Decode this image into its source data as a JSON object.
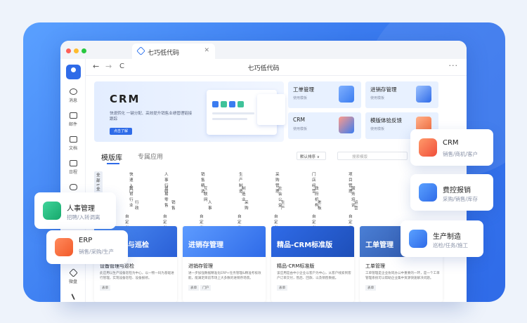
{
  "browser": {
    "tab_title": "七巧低代码",
    "address_title": "七巧低代码",
    "back": "←",
    "forward": "→",
    "reload": "C",
    "more": "···",
    "tab_close": "✕"
  },
  "sidebar": {
    "items": [
      {
        "label": "消息"
      },
      {
        "label": "邮件"
      },
      {
        "label": "文档"
      },
      {
        "label": "日程"
      },
      {
        "label": "会议"
      },
      {
        "label": "微盘"
      },
      {
        "label": "应用"
      }
    ]
  },
  "hero": {
    "title": "CRM",
    "desc": "快速转化 一键分配、高效提升销售业绩管理链接跟踪",
    "button": "点击了解"
  },
  "cards": [
    {
      "name": "工单管理",
      "sub": "使用模板"
    },
    {
      "name": "进销存管理",
      "sub": "使用模板"
    },
    {
      "name": "CRM",
      "sub": "使用模板"
    },
    {
      "name": "模版体验反馈",
      "sub": "使用模板"
    }
  ],
  "tabs": {
    "active": "模版库",
    "inactive": "专属应用"
  },
  "sort_label": "默认排序 ∨",
  "search_placeholder": "搜索模版",
  "filters": {
    "row1": [
      "全部场景",
      "快速入门",
      "人事行政",
      "销售精选",
      "生产制造",
      "采购管理",
      "门店经营",
      "项目管理"
    ],
    "row2": [
      "全部行业",
      "教育行业",
      "贸易零售",
      "互联网",
      "制造业",
      "社会公益",
      "政府机构",
      "服务培训"
    ],
    "row3": [
      "行政",
      "销售",
      "人事",
      "采购",
      "生产",
      "老板",
      "运营"
    ],
    "row4": [
      "自定义标签",
      "自定义标签",
      "自定义标签",
      "自定义标签",
      "自定义标签",
      "自定义标签",
      "自定义标签"
    ]
  },
  "templates": [
    {
      "img_title": "设备管理与巡检",
      "name": "设备管理与巡检",
      "desc": "此应用以生产设备巡检为中心，以一物一码为基础进行管理，实现设备巡检、设备报修。",
      "tags": [
        "表单"
      ]
    },
    {
      "img_title": "进销存管理",
      "name": "进销存管理",
      "desc": "进一步加强数据精准化ERP+任务管理&精准考核效能，能满足目前市场上大多数的进销存场景。",
      "tags": [
        "表单",
        "门户"
      ]
    },
    {
      "img_title": "精品-CRM标准版",
      "name": "精品-CRM标准版",
      "desc": "该应用是由中小企业以客户为中心，从客户线索到客户订单交付，售后、回款、以及销售数据。",
      "tags": [
        "表单"
      ]
    },
    {
      "img_title": "工单管理",
      "name": "工单管理",
      "desc": "工单管理是企业协同办公中重要的一环，是一个工单管理系统可以帮助企业集中资源快速解决问题。",
      "tags": [
        "表单"
      ]
    }
  ],
  "floats": [
    {
      "title": "人事管理",
      "sub": "招聘/入转调离"
    },
    {
      "title": "ERP",
      "sub": "销售/采购/生产"
    },
    {
      "title": "CRM",
      "sub": "销售/商机/客户"
    },
    {
      "title": "费控报销",
      "sub": "采购/销售/库存"
    },
    {
      "title": "生产制造",
      "sub": "巡检/任务/施工"
    }
  ],
  "colors": {
    "accent": "#2f6be8",
    "background": "#eef3fb"
  }
}
